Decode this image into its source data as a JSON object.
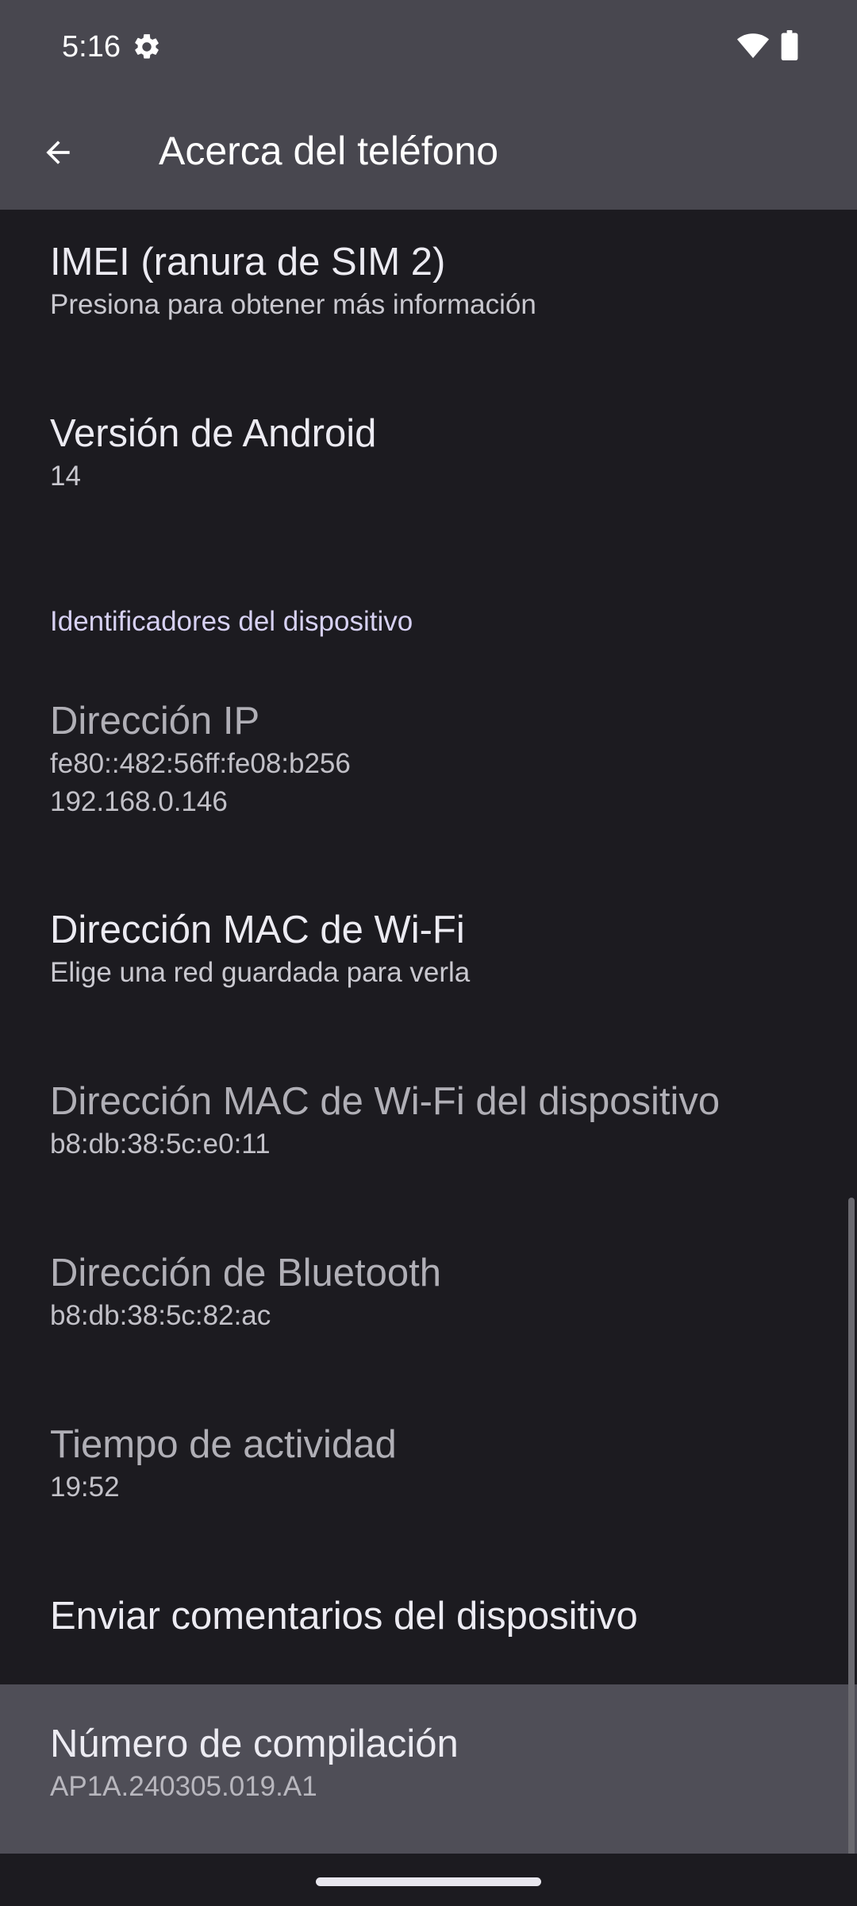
{
  "status_bar": {
    "time": "5:16",
    "icons": [
      "gear-icon",
      "wifi-icon",
      "battery-icon"
    ]
  },
  "app_bar": {
    "back_icon": "arrow-back-icon",
    "title": "Acerca del teléfono"
  },
  "items": {
    "imei_sim2": {
      "title": "IMEI (ranura de SIM 2)",
      "summary": "Presiona para obtener más información"
    },
    "android_version": {
      "title": "Versión de Android",
      "summary": "14"
    },
    "device_identifiers_header": "Identificadores del dispositivo",
    "ip_address": {
      "title": "Dirección IP",
      "summary_line1": "fe80::482:56ff:fe08:b256",
      "summary_line2": "192.168.0.146"
    },
    "wifi_mac": {
      "title": "Dirección MAC de Wi-Fi",
      "summary": "Elige una red guardada para verla"
    },
    "device_wifi_mac": {
      "title": "Dirección MAC de Wi-Fi del dispositivo",
      "summary": "b8:db:38:5c:e0:11"
    },
    "bluetooth_address": {
      "title": "Dirección de Bluetooth",
      "summary": "b8:db:38:5c:82:ac"
    },
    "uptime": {
      "title": "Tiempo de actividad",
      "summary": "19:52"
    },
    "send_feedback": {
      "title": "Enviar comentarios del dispositivo"
    },
    "build_number": {
      "title": "Número de compilación",
      "summary": "AP1A.240305.019.A1"
    }
  },
  "colors": {
    "header_bg": "#48474f",
    "screen_bg": "#1c1b20",
    "highlight_bg": "#4f4e57",
    "category_text": "#d7d1f3"
  }
}
